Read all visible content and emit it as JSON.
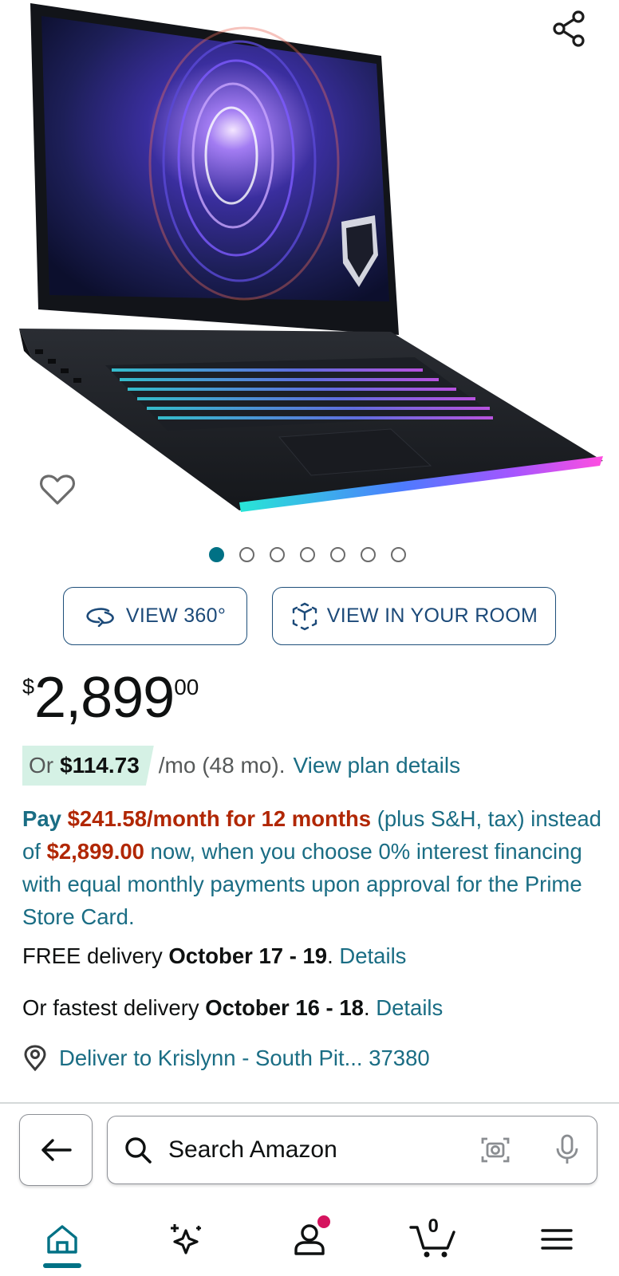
{
  "product": {
    "image_alt": "MSI gaming laptop",
    "carousel_total": 7,
    "carousel_active_index": 0
  },
  "view_buttons": {
    "view_360": "VIEW 360°",
    "view_room": "VIEW IN YOUR ROOM"
  },
  "price": {
    "symbol": "$",
    "whole": "2,899",
    "fraction": "00"
  },
  "monthly": {
    "or": "Or",
    "amount": "$114.73",
    "terms": "/mo (48 mo).",
    "link": "View plan details"
  },
  "financing": {
    "pay": "Pay",
    "monthly_amount": "$241.58/month for 12 months",
    "suffix1": " (plus S&H, tax) instead of ",
    "full_price": "$2,899.00",
    "suffix2": " now, when you choose 0% interest financing with equal monthly payments upon approval for the Prime Store Card."
  },
  "delivery": {
    "free_prefix": "FREE delivery ",
    "free_dates": "October 17 - 19",
    "free_dot": ". ",
    "free_link": "Details",
    "fast_prefix": "Or fastest delivery ",
    "fast_dates": "October 16 - 18",
    "fast_dot": ". ",
    "fast_link": "Details"
  },
  "location": {
    "text": "Deliver to Krislynn - South Pit... 37380"
  },
  "search": {
    "placeholder": "Search Amazon"
  },
  "nav": {
    "cart_count": "0",
    "items": [
      "home-icon",
      "sparkle-icon",
      "account-icon",
      "cart-icon",
      "menu-icon"
    ]
  },
  "colors": {
    "accent": "#007185",
    "link": "#1a6d84",
    "price_red": "#b12704",
    "badge_green": "#d5f1e5",
    "notification": "#d5135e"
  }
}
